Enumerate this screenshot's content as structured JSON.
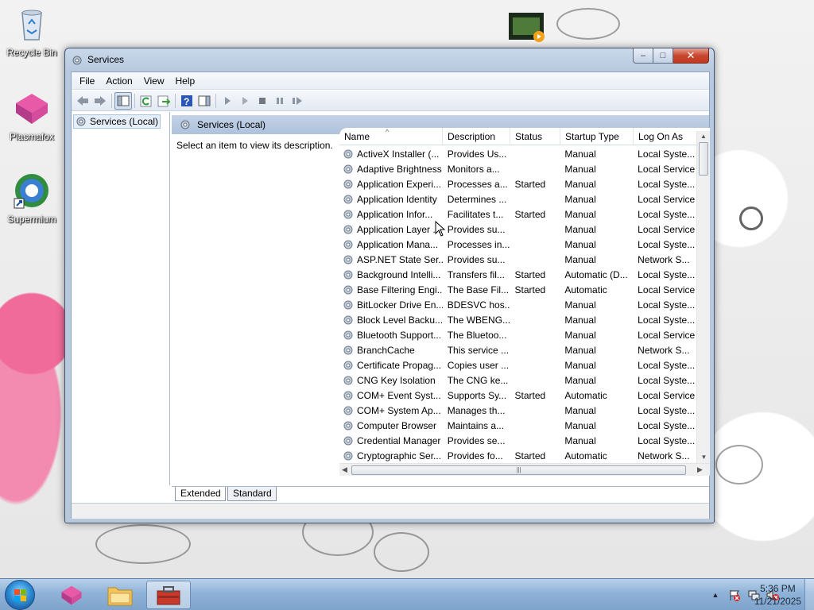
{
  "desktop": {
    "icons": [
      {
        "label": "Recycle Bin",
        "icon": "recycle-bin-icon"
      },
      {
        "label": "Plasmafox",
        "icon": "plasmafox-icon"
      },
      {
        "label": "Supermium",
        "icon": "supermium-icon"
      }
    ]
  },
  "window": {
    "title": "Services",
    "buttons": {
      "minimize": "–",
      "maximize": "□",
      "close": "✕"
    },
    "menu": [
      "File",
      "Action",
      "View",
      "Help"
    ],
    "tree": {
      "selected_label": "Services (Local)"
    },
    "pane_header": "Services (Local)",
    "description_hint": "Select an item to view its description.",
    "columns": [
      "Name",
      "Description",
      "Status",
      "Startup Type",
      "Log On As"
    ],
    "rows": [
      [
        "ActiveX Installer (...",
        "Provides Us...",
        "",
        "Manual",
        "Local Syste..."
      ],
      [
        "Adaptive Brightness",
        "Monitors a...",
        "",
        "Manual",
        "Local Service"
      ],
      [
        "Application Experi...",
        "Processes a...",
        "Started",
        "Manual",
        "Local Syste..."
      ],
      [
        "Application Identity",
        "Determines ...",
        "",
        "Manual",
        "Local Service"
      ],
      [
        "Application Infor...",
        "Facilitates t...",
        "Started",
        "Manual",
        "Local Syste..."
      ],
      [
        "Application Layer ...",
        "Provides su...",
        "",
        "Manual",
        "Local Service"
      ],
      [
        "Application Mana...",
        "Processes in...",
        "",
        "Manual",
        "Local Syste..."
      ],
      [
        "ASP.NET State Ser...",
        "Provides su...",
        "",
        "Manual",
        "Network S..."
      ],
      [
        "Background Intelli...",
        "Transfers fil...",
        "Started",
        "Automatic (D...",
        "Local Syste..."
      ],
      [
        "Base Filtering Engi...",
        "The Base Fil...",
        "Started",
        "Automatic",
        "Local Service"
      ],
      [
        "BitLocker Drive En...",
        "BDESVC hos...",
        "",
        "Manual",
        "Local Syste..."
      ],
      [
        "Block Level Backu...",
        "The WBENG...",
        "",
        "Manual",
        "Local Syste..."
      ],
      [
        "Bluetooth Support...",
        "The Bluetoo...",
        "",
        "Manual",
        "Local Service"
      ],
      [
        "BranchCache",
        "This service ...",
        "",
        "Manual",
        "Network S..."
      ],
      [
        "Certificate Propag...",
        "Copies user ...",
        "",
        "Manual",
        "Local Syste..."
      ],
      [
        "CNG Key Isolation",
        "The CNG ke...",
        "",
        "Manual",
        "Local Syste..."
      ],
      [
        "COM+ Event Syst...",
        "Supports Sy...",
        "Started",
        "Automatic",
        "Local Service"
      ],
      [
        "COM+ System Ap...",
        "Manages th...",
        "",
        "Manual",
        "Local Syste..."
      ],
      [
        "Computer Browser",
        "Maintains a...",
        "",
        "Manual",
        "Local Syste..."
      ],
      [
        "Credential Manager",
        "Provides se...",
        "",
        "Manual",
        "Local Syste..."
      ],
      [
        "Cryptographic Ser...",
        "Provides fo...",
        "Started",
        "Automatic",
        "Network S..."
      ]
    ],
    "tabs": [
      "Extended",
      "Standard"
    ]
  },
  "taskbar": {
    "clock_time": "5:36 PM",
    "clock_date": "11/21/2025",
    "tray_chevron": "▲"
  },
  "colors": {
    "title_gradient_top": "#c9d8ea",
    "pane_header": "#b7c9df",
    "close_button": "#c7462f",
    "taskbar": "#8fb2d8"
  }
}
